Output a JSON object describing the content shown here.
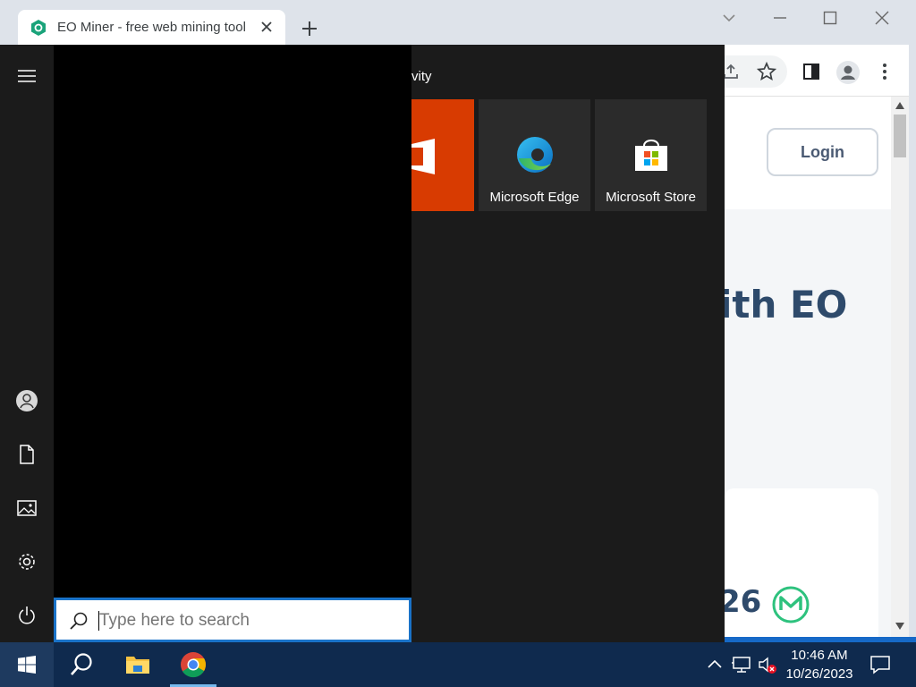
{
  "browser": {
    "tab_title": "EO Miner - free web mining tool",
    "page": {
      "login_label": "Login",
      "hero_fragment": "ith EO",
      "card_number_fragment": "26"
    }
  },
  "start_menu": {
    "tiles_header_fragment": "vity",
    "tiles": [
      {
        "label": "",
        "icon": "office-icon"
      },
      {
        "label": "Microsoft Edge",
        "icon": "edge-icon"
      },
      {
        "label": "Microsoft Store",
        "icon": "store-icon"
      }
    ],
    "search_placeholder": "Type here to search",
    "rail_icons": [
      "hamburger-icon",
      "user-icon",
      "documents-icon",
      "pictures-icon",
      "settings-icon",
      "power-icon"
    ]
  },
  "taskbar": {
    "apps": [
      "search-icon",
      "file-explorer-icon",
      "chrome-icon"
    ],
    "clock_time": "10:46 AM",
    "clock_date": "10/26/2023"
  },
  "colors": {
    "accent": "#1a73c9",
    "office": "#d83b01",
    "taskbar": "#0f2a4e",
    "start_bg": "#1b1b1b"
  }
}
